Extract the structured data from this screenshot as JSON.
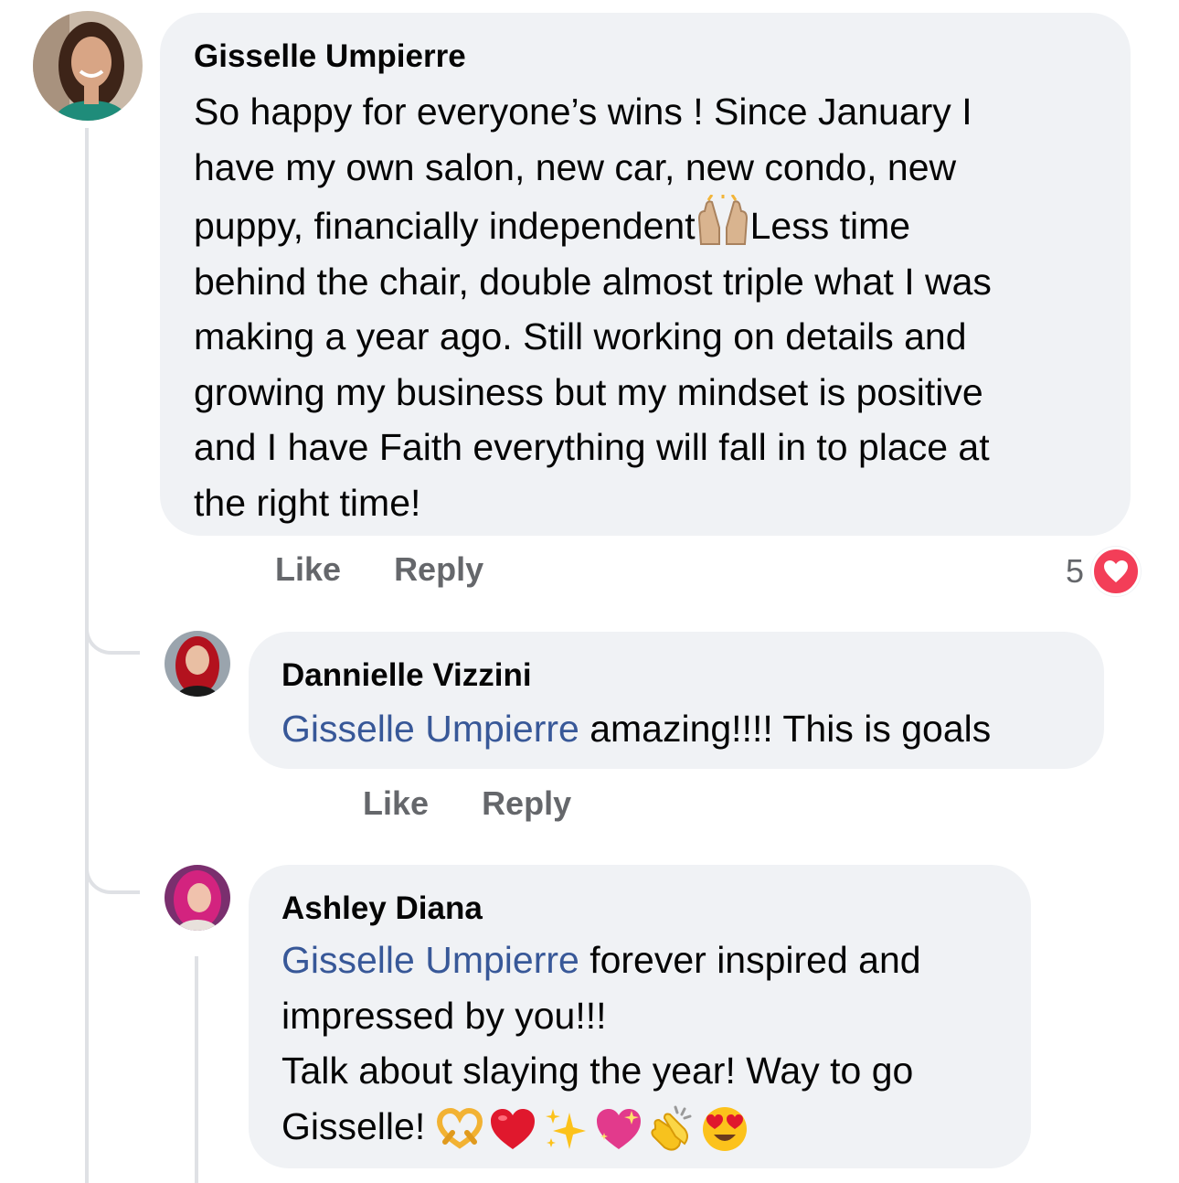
{
  "comments": [
    {
      "author": "Gisselle Umpierre",
      "lines": [
        "So happy for everyone’s wins ! Since January I",
        "have my own salon, new car, new condo, new",
        "puppy, financially independent",
        "behind the chair, double almost triple what I was",
        "making a year ago. Still working on details and",
        "growing my business but my mindset is positive",
        "and I have Faith everything will fall in to place at",
        "the right time!"
      ],
      "line3_after_emoji": "Less time",
      "like_label": "Like",
      "reply_label": "Reply",
      "reaction_count": "5",
      "reaction_icon": "heart-icon"
    }
  ],
  "replies": [
    {
      "author": "Dannielle Vizzini",
      "mention": "Gisselle Umpierre",
      "text": " amazing!!!! This is goals",
      "like_label": "Like",
      "reply_label": "Reply"
    },
    {
      "author": "Ashley Diana",
      "mention": "Gisselle Umpierre",
      "line1": " forever inspired and",
      "line2": "impressed by you!!!",
      "line3": "Talk about slaying the year! Way to go",
      "line4": "Gisselle!",
      "emojis": [
        "heart-hands-emoji",
        "red-heart-emoji",
        "sparkles-emoji",
        "sparkling-heart-emoji",
        "clapping-hands-emoji",
        "heart-eyes-emoji"
      ]
    }
  ],
  "colors": {
    "bubble": "#f0f2f5",
    "mention": "#385898",
    "action_text": "#65676b",
    "love_reaction": "#f33e58",
    "thread_line": "#dfe1e5"
  }
}
